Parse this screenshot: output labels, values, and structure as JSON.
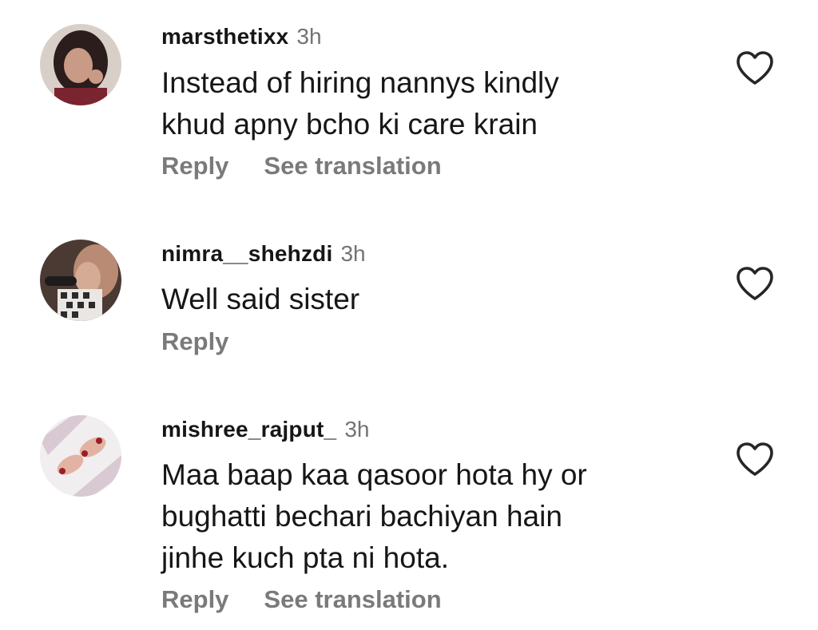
{
  "comments": [
    {
      "username": "marsthetixx",
      "time": "3h",
      "text": "Instead of hiring nannys kindly\nkhud apny bcho ki care krain",
      "actions": {
        "reply": "Reply",
        "translate": "See translation"
      },
      "like_icon": "heart-outline-icon"
    },
    {
      "username": "nimra__shehzdi",
      "time": "3h",
      "text": "Well said sister",
      "actions": {
        "reply": "Reply"
      },
      "like_icon": "heart-outline-icon"
    },
    {
      "username": "mishree_rajput_",
      "time": "3h",
      "text": "Maa baap kaa qasoor hota hy or\nbughatti bechari bachiyan  hain\njinhe kuch pta ni hota.",
      "actions": {
        "reply": "Reply",
        "translate": "See translation"
      },
      "like_icon": "heart-outline-icon"
    }
  ],
  "colors": {
    "primary_text": "#161616",
    "secondary_text": "#737373",
    "action_text": "#7a7a7a",
    "background": "#ffffff"
  }
}
